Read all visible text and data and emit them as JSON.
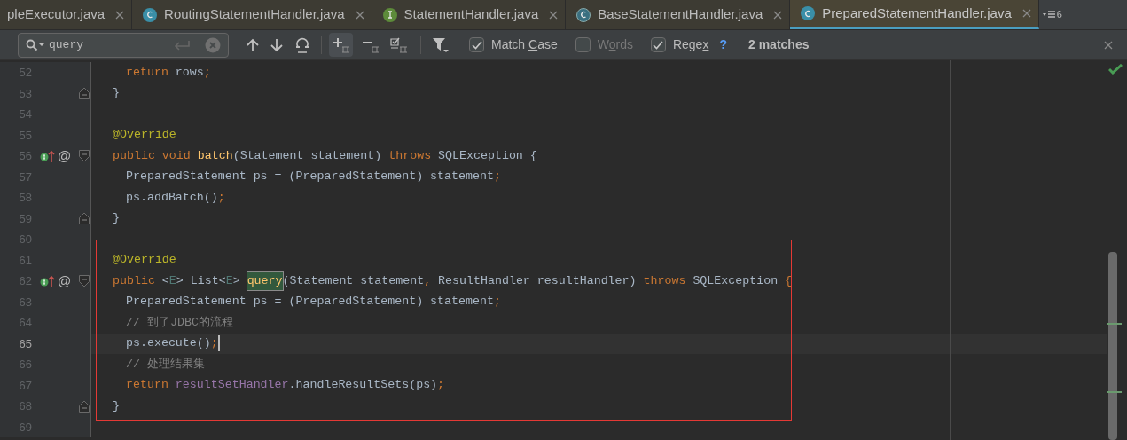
{
  "tabs": [
    {
      "label": "pleExecutor.java",
      "kind": "plain",
      "selected": false
    },
    {
      "label": "RoutingStatementHandler.java",
      "kind": "class",
      "selected": false
    },
    {
      "label": "StatementHandler.java",
      "kind": "interface",
      "selected": false
    },
    {
      "label": "BaseStatementHandler.java",
      "kind": "abstract",
      "selected": false
    },
    {
      "label": "PreparedStatementHandler.java",
      "kind": "class",
      "selected": true
    }
  ],
  "tab_overflow": {
    "count": "6"
  },
  "search": {
    "value": "query",
    "options": [
      {
        "before": "Match ",
        "mnemonic": "C",
        "after": "ase",
        "checked": true
      },
      {
        "before": "W",
        "mnemonic": "o",
        "after": "rds",
        "checked": false
      },
      {
        "before": "Rege",
        "mnemonic": "x",
        "checked": true
      }
    ],
    "help": "?",
    "matches": "2 matches"
  },
  "lines": [
    {
      "number": "52",
      "body": true,
      "tokens": [
        {
          "kind": "kw",
          "text": "return"
        },
        {
          "kind": "id",
          "text": " rows"
        },
        {
          "kind": "punct",
          "text": ";"
        }
      ]
    },
    {
      "number": "53",
      "fold": {
        "kind": "close"
      },
      "tokens": [
        {
          "kind": "id",
          "text": "}"
        }
      ]
    },
    {
      "number": "54"
    },
    {
      "number": "55",
      "tokens": [
        {
          "kind": "ann",
          "text": "@Override"
        }
      ]
    },
    {
      "number": "56",
      "fold": {
        "kind": "open"
      },
      "markers": {
        "implements": true,
        "at": "@"
      },
      "tokens": [
        {
          "kind": "kw",
          "text": "public void "
        },
        {
          "kind": "decl",
          "text": "batch"
        },
        {
          "kind": "id",
          "text": "(Statement statement) "
        },
        {
          "kind": "kw",
          "text": "throws "
        },
        {
          "kind": "id",
          "text": "SQLException {"
        }
      ]
    },
    {
      "number": "57",
      "body": true,
      "tokens": [
        {
          "kind": "id",
          "text": "PreparedStatement ps = (PreparedStatement) statement"
        },
        {
          "kind": "punct",
          "text": ";"
        }
      ]
    },
    {
      "number": "58",
      "body": true,
      "tokens": [
        {
          "kind": "id",
          "text": "ps.addBatch()"
        },
        {
          "kind": "punct",
          "text": ";"
        }
      ]
    },
    {
      "number": "59",
      "fold": {
        "kind": "close"
      },
      "tokens": [
        {
          "kind": "id",
          "text": "}"
        }
      ]
    },
    {
      "number": "60"
    },
    {
      "number": "61",
      "boxed": true,
      "tokens": [
        {
          "kind": "ann",
          "text": "@Override"
        }
      ]
    },
    {
      "number": "62",
      "boxed": true,
      "fold": {
        "kind": "open"
      },
      "markers": {
        "implements": true,
        "at": "@"
      },
      "tokens": [
        {
          "kind": "kw",
          "text": "public "
        },
        {
          "kind": "id",
          "text": "<"
        },
        {
          "kind": "tp",
          "text": "E"
        },
        {
          "kind": "id",
          "text": "> List<"
        },
        {
          "kind": "tp",
          "text": "E"
        },
        {
          "kind": "id",
          "text": "> "
        },
        {
          "kind": "match",
          "text": "query"
        },
        {
          "kind": "id",
          "text": "(Statement statement"
        },
        {
          "kind": "punct",
          "text": ", "
        },
        {
          "kind": "id",
          "text": "ResultHandler resultHandler) "
        },
        {
          "kind": "kw",
          "text": "throws "
        },
        {
          "kind": "id",
          "text": "SQLException "
        },
        {
          "kind": "punct",
          "text": "{"
        }
      ]
    },
    {
      "number": "63",
      "boxed": true,
      "body": true,
      "tokens": [
        {
          "kind": "id",
          "text": "PreparedStatement ps = (PreparedStatement) statement"
        },
        {
          "kind": "punct",
          "text": ";"
        }
      ]
    },
    {
      "number": "64",
      "boxed": true,
      "body": true,
      "tokens": [
        {
          "kind": "cmt",
          "text": "// 到了JDBC的流程"
        }
      ]
    },
    {
      "number": "65",
      "boxed": true,
      "body": true,
      "current": true,
      "tokens": [
        {
          "kind": "id",
          "text": "ps.execute()"
        },
        {
          "kind": "punct",
          "text": ";"
        }
      ]
    },
    {
      "number": "66",
      "boxed": true,
      "body": true,
      "tokens": [
        {
          "kind": "cmt",
          "text": "// 处理结果集"
        }
      ]
    },
    {
      "number": "67",
      "boxed": true,
      "body": true,
      "tokens": [
        {
          "kind": "kw",
          "text": "return "
        },
        {
          "kind": "field",
          "text": "resultSetHandler"
        },
        {
          "kind": "id",
          "text": ".handleResultSets(ps)"
        },
        {
          "kind": "punct",
          "text": ";"
        }
      ]
    },
    {
      "number": "68",
      "boxed": true,
      "fold": {
        "kind": "close"
      },
      "tokens": [
        {
          "kind": "id",
          "text": "}"
        }
      ]
    },
    {
      "number": "69"
    }
  ]
}
